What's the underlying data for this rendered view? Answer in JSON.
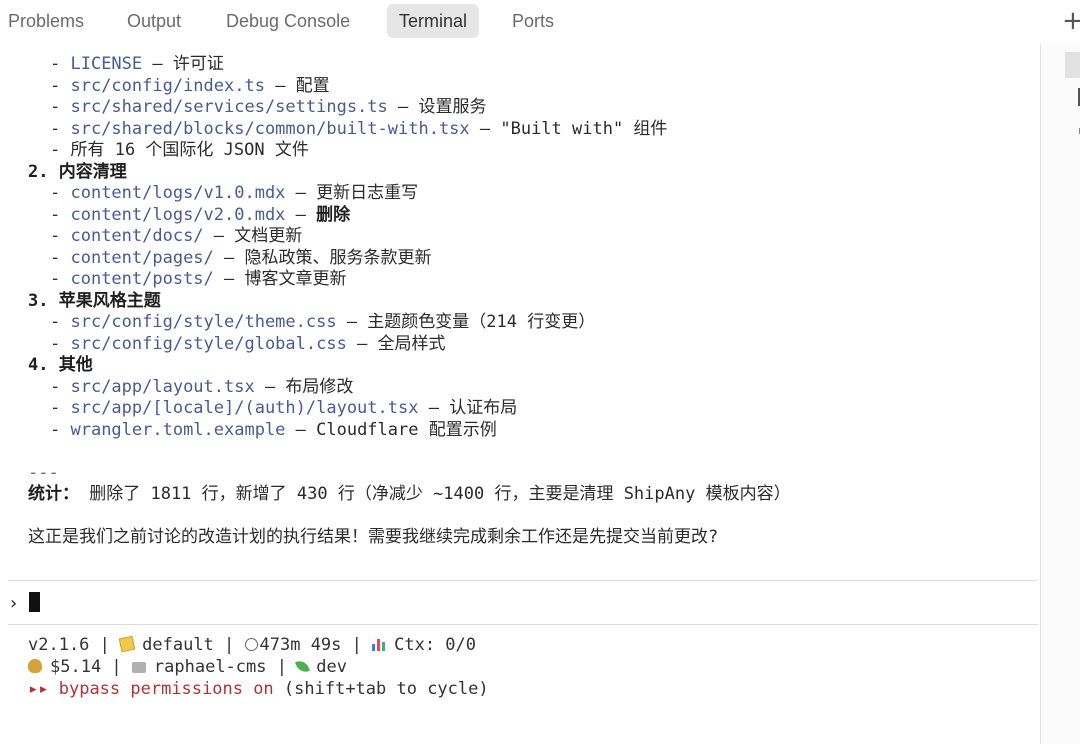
{
  "tabs": [
    {
      "label": "Problems",
      "active": false
    },
    {
      "label": "Output",
      "active": false
    },
    {
      "label": "Debug Console",
      "active": false
    },
    {
      "label": "Terminal",
      "active": true
    },
    {
      "label": "Ports",
      "active": false
    }
  ],
  "new_terminal_icon": "plus-icon",
  "terminal": {
    "section1": {
      "items": [
        {
          "path": "LICENSE",
          "desc": " – 许可证"
        },
        {
          "path": "src/config/index.ts",
          "desc": " – 配置"
        },
        {
          "path": "src/shared/services/settings.ts",
          "desc": " – 设置服务"
        },
        {
          "path": "src/shared/blocks/common/built-with.tsx",
          "desc": " – \"Built with\" 组件"
        },
        {
          "path": "",
          "desc": "所有 16 个国际化 JSON 文件"
        }
      ]
    },
    "section2": {
      "heading": "2. 内容清理",
      "items": [
        {
          "path": "content/logs/v1.0.mdx",
          "desc": " – 更新日志重写"
        },
        {
          "path": "content/logs/v2.0.mdx",
          "desc": " – ",
          "strong": "删除"
        },
        {
          "path": "content/docs/",
          "desc": " – 文档更新"
        },
        {
          "path": "content/pages/",
          "desc": " – 隐私政策、服务条款更新"
        },
        {
          "path": "content/posts/",
          "desc": " – 博客文章更新"
        }
      ]
    },
    "section3": {
      "heading": "3. 苹果风格主题",
      "items": [
        {
          "path": "src/config/style/theme.css",
          "desc": " – 主题颜色变量（214 行变更）"
        },
        {
          "path": "src/config/style/global.css",
          "desc": " – 全局样式"
        }
      ]
    },
    "section4": {
      "heading": "4. 其他",
      "items": [
        {
          "path": "src/app/layout.tsx",
          "desc": " – 布局修改"
        },
        {
          "path": "src/app/[locale]/(auth)/layout.tsx",
          "desc": " – 认证布局"
        },
        {
          "path": "wrangler.toml.example",
          "desc": " – Cloudflare 配置示例"
        }
      ]
    },
    "bullet": "- ",
    "rule": "---",
    "stats_label": "统计：",
    "stats_text": " 删除了 1811 行，新增了 430 行（净减少 ~1400 行，主要是清理 ShipAny 模板内容）",
    "question": "这正是我们之前讨论的改造计划的执行结果！需要我继续完成剩余工作还是先提交当前更改?"
  },
  "prompt": {
    "symbol": "›",
    "value": ""
  },
  "status": {
    "version": "v2.1.6",
    "divider": " | ",
    "style": "default",
    "duration": "473m 49s",
    "ctx": "Ctx: 0/0",
    "cost": "$5.14",
    "project": "raphael-cms",
    "branch": "dev",
    "bypass_arrows": "▸▸",
    "bypass_text": "bypass permissions on",
    "bypass_hint": " (shift+tab to cycle)"
  },
  "colors": {
    "path": "#475b94",
    "warning": "#b5303a",
    "active_tab_bg": "#e6e6e6"
  }
}
